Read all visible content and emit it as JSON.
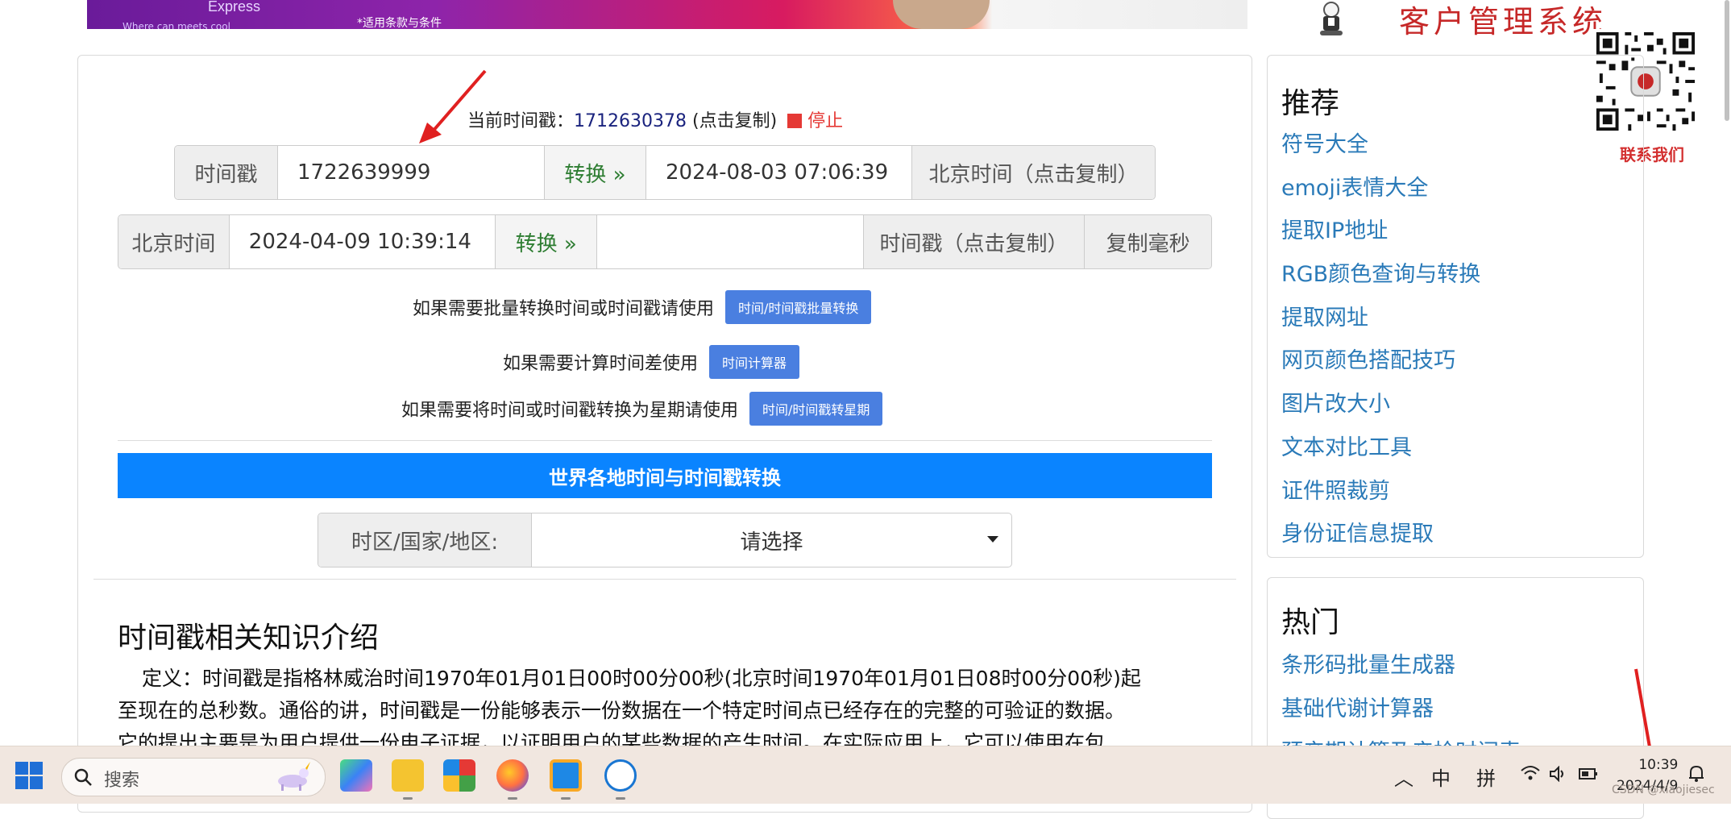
{
  "banner": {
    "brand": "Express",
    "terms": "*适用条款与条件",
    "small": "Where can meets cool",
    "site_title": "客户管理系统"
  },
  "qr": {
    "label": "联系我们"
  },
  "current": {
    "label": "当前时间戳：",
    "value": "1712630378",
    "copy_hint": "(点击复制)",
    "stop": "停止"
  },
  "ts_to_date": {
    "prefix": "时间戳",
    "input_value": "1722639999",
    "convert": "转换 »",
    "output_value": "2024-08-03 07:06:39",
    "suffix": "北京时间（点击复制）"
  },
  "date_to_ts": {
    "prefix": "北京时间",
    "input_value": "2024-04-09 10:39:14",
    "convert": "转换 »",
    "output_value": "",
    "suffix": "时间戳（点击复制）",
    "ms": "复制毫秒"
  },
  "hints": [
    {
      "text": "如果需要批量转换时间或时间戳请使用",
      "button": "时间/时间戳批量转换"
    },
    {
      "text": "如果需要计算时间差使用",
      "button": "时间计算器"
    },
    {
      "text": "如果需要将时间或时间戳转换为星期请使用",
      "button": "时间/时间戳转星期"
    }
  ],
  "world": {
    "bar": "世界各地时间与时间戳转换",
    "tz_label": "时区/国家/地区:",
    "tz_selected": "请选择"
  },
  "article": {
    "title": "时间戳相关知识介绍",
    "line1": "定义：时间戳是指格林威治时间1970年01月01日00时00分00秒(北京时间1970年01月01日08时00分00秒)起",
    "line2": "至现在的总秒数。通俗的讲，时间戳是一份能够表示一份数据在一个特定时间点已经存在的完整的可验证的数据。",
    "line3": "它的提出主要是为用户提供一份电子证据，以证明用户的某些数据的产生时间。在实际应用上，它可以使用在包"
  },
  "sidebar": {
    "recommend_title": "推荐",
    "recommend": [
      "符号大全",
      "emoji表情大全",
      "提取IP地址",
      "RGB颜色查询与转换",
      "提取网址",
      "网页颜色搭配技巧",
      "图片改大小",
      "文本对比工具",
      "证件照裁剪",
      "身份证信息提取"
    ],
    "hot_title": "热门",
    "hot": [
      "条形码批量生成器",
      "基础代谢计算器",
      "预产期计算及产检时间表"
    ]
  },
  "taskbar": {
    "search_placeholder": "搜索",
    "ime_mode": "中",
    "ime_name": "拼",
    "time": "10:39",
    "date": "2024/4/9",
    "watermark": "CSDN @xiaojiesec"
  },
  "colors": {
    "accent_blue": "#0a84ff",
    "button_blue": "#4a7fe0",
    "convert_green": "#2e7d32",
    "stop_red": "#e53935",
    "link_blue": "#2a7ab8",
    "arrow_red": "#e02020"
  }
}
